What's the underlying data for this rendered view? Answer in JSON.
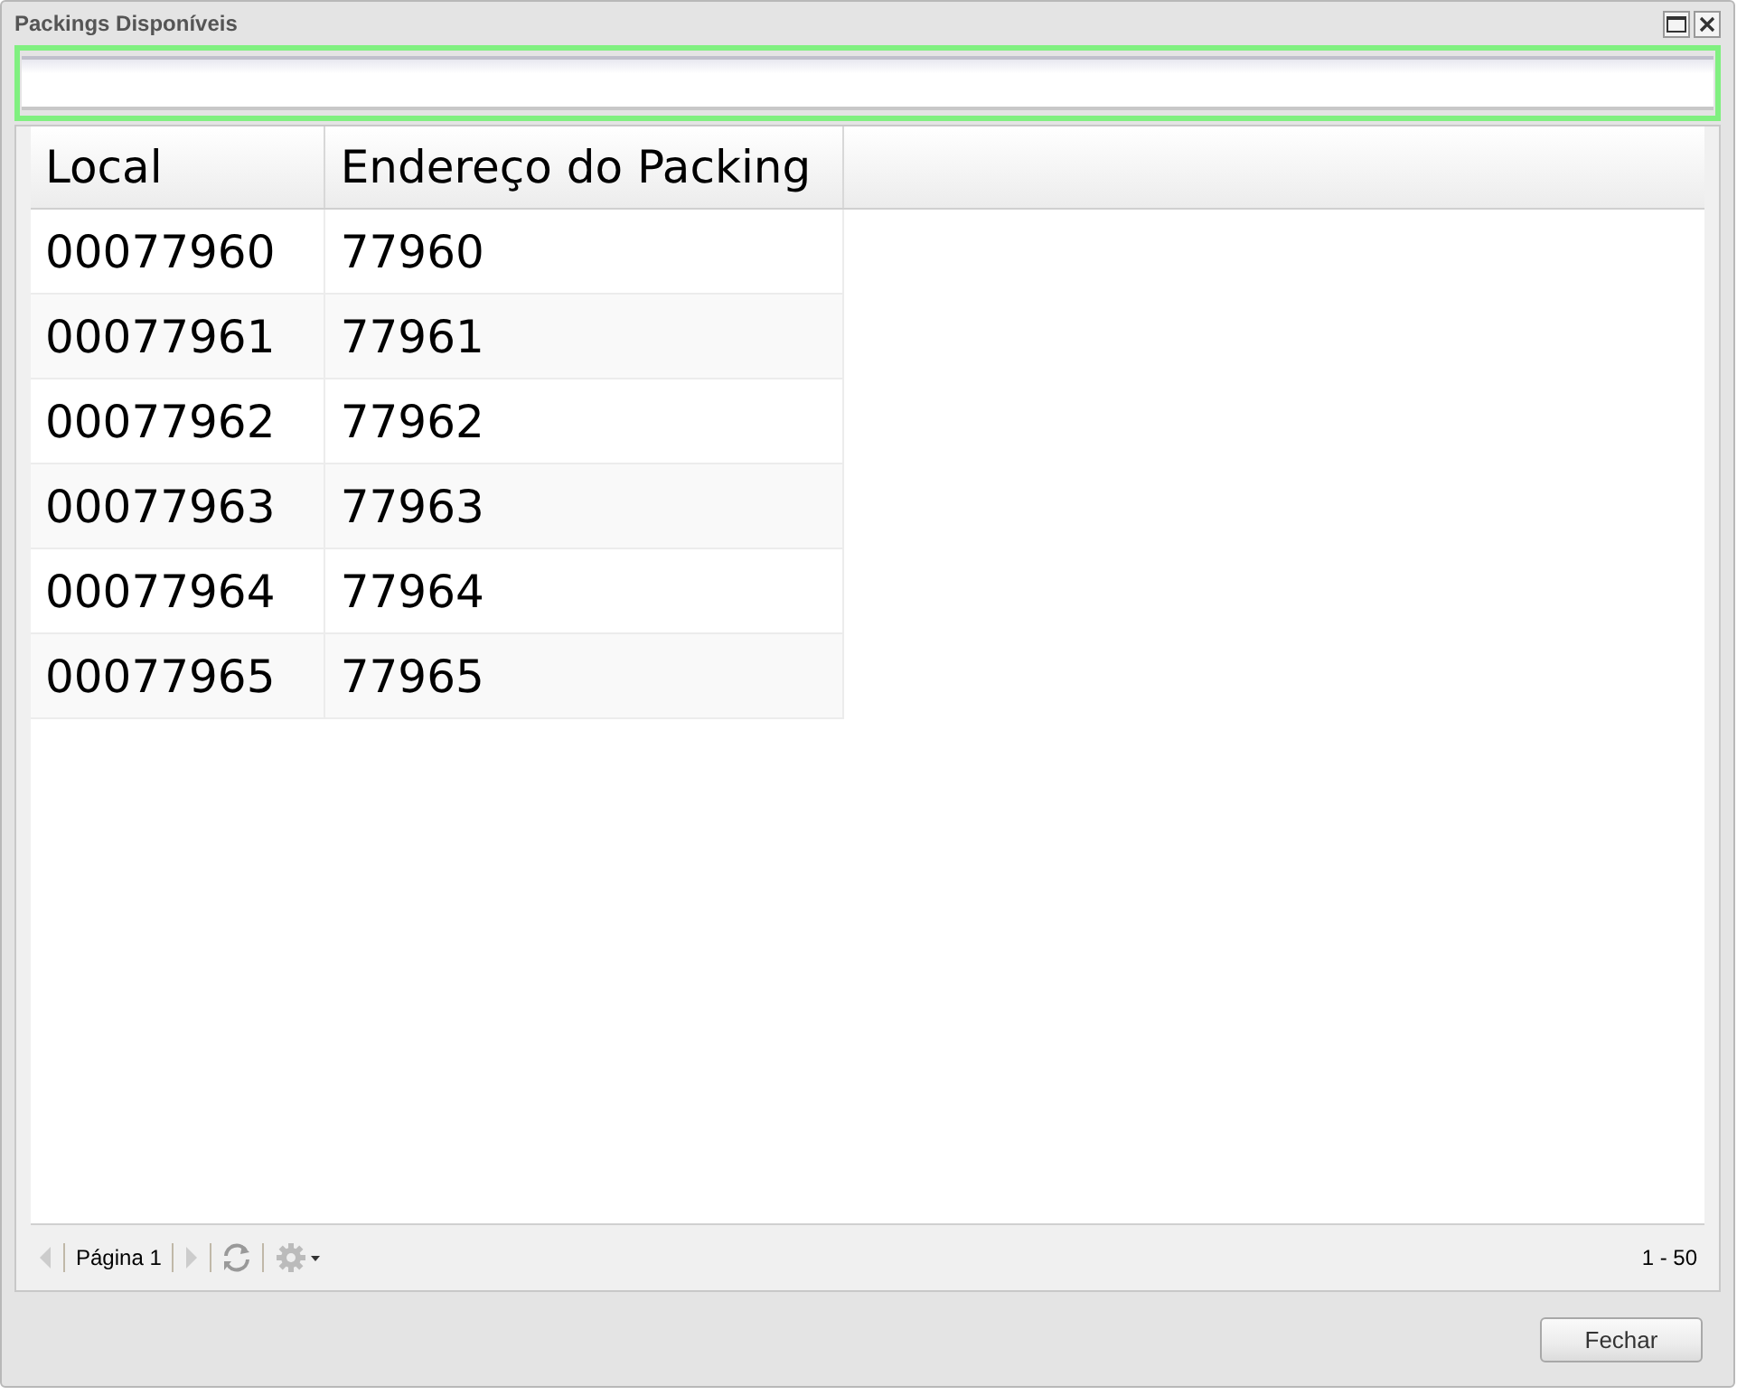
{
  "window": {
    "title": "Packings Disponíveis"
  },
  "table": {
    "columns": [
      "Local",
      "Endereço do Packing"
    ],
    "rows": [
      [
        "00077960",
        "77960"
      ],
      [
        "00077961",
        "77961"
      ],
      [
        "00077962",
        "77962"
      ],
      [
        "00077963",
        "77963"
      ],
      [
        "00077964",
        "77964"
      ],
      [
        "00077965",
        "77965"
      ]
    ]
  },
  "pager": {
    "page_label": "Página 1",
    "range": "1 - 50"
  },
  "buttons": [
    "Fechar"
  ]
}
